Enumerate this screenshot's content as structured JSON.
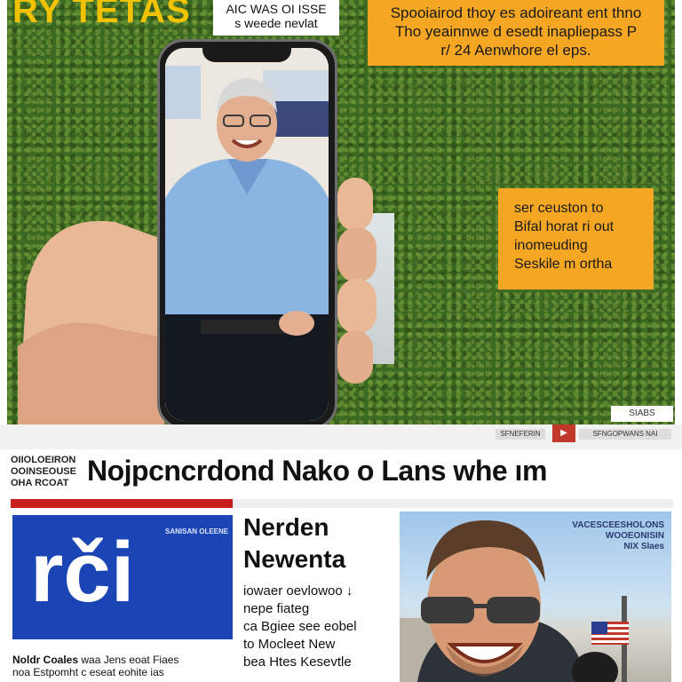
{
  "top": {
    "brand": "RY TETAS",
    "quote": [
      "AIC WAS OI ISSE",
      "s weede nevlat"
    ],
    "banner_top": [
      "Spooiairod thoy es adoireant ent thno",
      "Tho yeainnwe d esedt inapliepass P",
      "r/ 24 Aenwhore el eps."
    ],
    "banner_side": [
      "ser ceuston to",
      "Bifal horat ri out",
      "inomeuding",
      "Seskile m ortha"
    ]
  },
  "strip": {
    "badge": "SIABS",
    "item1": "SFNEFERIN",
    "item2": "SFNGOPWANS NAI"
  },
  "masthead": {
    "side": [
      "OIIOLOEIRON",
      "OOINSEOUSE",
      "OHA RCOAT"
    ],
    "title": "Nojpcncrdond Nako o Lans  whe ım"
  },
  "logo": {
    "text": "rči",
    "tag": "SANISAN OLEENE"
  },
  "article": {
    "headline": [
      "Nerden",
      "Newenta"
    ],
    "body": [
      "iowaer oevlowoo  ↓",
      "nepe fiateg",
      "ca Bgiee see eobel",
      "to Mocleet New",
      "bea Htes Kesevtle"
    ]
  },
  "caption": {
    "bold": "Noldr Coales",
    "rest": " waa Jens eoat Fiaes",
    "line2": "noa Estpomht c eseat eohite ias"
  },
  "photo": {
    "note": [
      "VACESCEESHOLONS",
      "WOOEONISIN",
      "NIX Slaes"
    ]
  }
}
